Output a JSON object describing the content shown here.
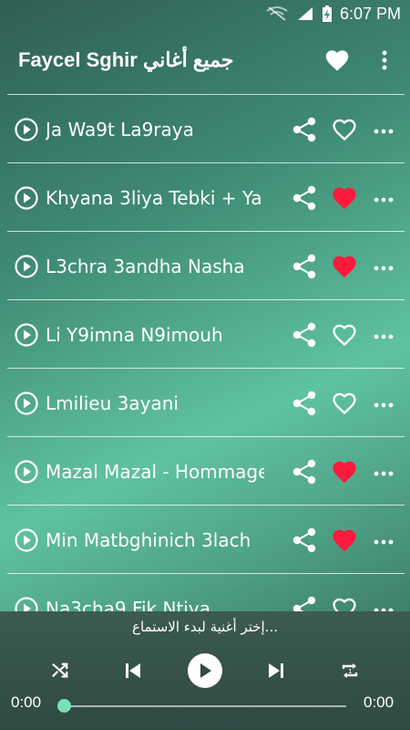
{
  "status_bar": {
    "time": "6:07 PM"
  },
  "app_bar": {
    "title": "Faycel Sghir جميع أغاني"
  },
  "songs": [
    {
      "title": "Ja Wa9t La9raya",
      "favorite": false
    },
    {
      "title": "Khyana 3liya Tebki + Ya",
      "favorite": true
    },
    {
      "title": "L3chra 3andha Nasha",
      "favorite": true
    },
    {
      "title": "Li Y9imna N9imouh",
      "favorite": false
    },
    {
      "title": "Lmilieu 3ayani",
      "favorite": false
    },
    {
      "title": "Mazal Mazal - Hommage",
      "favorite": true
    },
    {
      "title": "Min Matbghinich 3lach",
      "favorite": true
    },
    {
      "title": "Na3cha9 Fik Ntiya",
      "favorite": false
    }
  ],
  "player": {
    "hint": "إختر أغنية لبدء الاستماع...",
    "elapsed": "0:00",
    "duration": "0:00",
    "progress": 0
  },
  "colors": {
    "heart_active": "#ff1a3c",
    "thumb": "#79e1b8"
  }
}
